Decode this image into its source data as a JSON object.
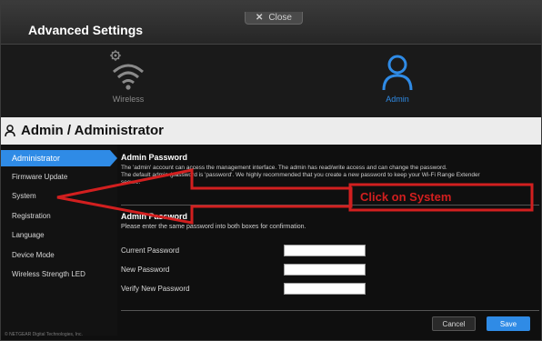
{
  "window": {
    "close_label": "Close",
    "title": "Advanced Settings"
  },
  "categories": [
    {
      "label": "Wireless",
      "icon": "wifi-gear-icon",
      "active": false
    },
    {
      "label": "Admin",
      "icon": "user-icon",
      "active": true
    }
  ],
  "section": {
    "title": "Admin / Administrator",
    "icon": "user-icon"
  },
  "sidebar": {
    "items": [
      {
        "label": "Administrator",
        "active": true
      },
      {
        "label": "Firmware Update",
        "active": false
      },
      {
        "label": "System",
        "active": false
      },
      {
        "label": "Registration",
        "active": false
      },
      {
        "label": "Language",
        "active": false
      },
      {
        "label": "Device Mode",
        "active": false
      },
      {
        "label": "Wireless Strength LED",
        "active": false
      }
    ]
  },
  "main": {
    "admin_password_heading": "Admin Password",
    "description_line1": "The 'admin' account can access the management interface. The admin has read/write access and can change the password.",
    "description_line2": "The default admin (password is 'password'. We highly recommended that you create a new password to keep your Wi-Fi Range Extender",
    "description_line3": "secure.",
    "admin_password_heading2": "Admin Password",
    "hint": "Please enter the same password into both boxes for confirmation.",
    "fields": [
      {
        "label": "Current Password",
        "value": ""
      },
      {
        "label": "New Password",
        "value": ""
      },
      {
        "label": "Verify New Password",
        "value": ""
      }
    ],
    "cancel_label": "Cancel",
    "save_label": "Save"
  },
  "footer": {
    "copyright": "© NETGEAR Digital Technologies, Inc."
  },
  "annotation": {
    "text": "Click on System",
    "color": "#d21f1f"
  },
  "colors": {
    "accent": "#2f8be6",
    "background": "#0f0f0f"
  }
}
